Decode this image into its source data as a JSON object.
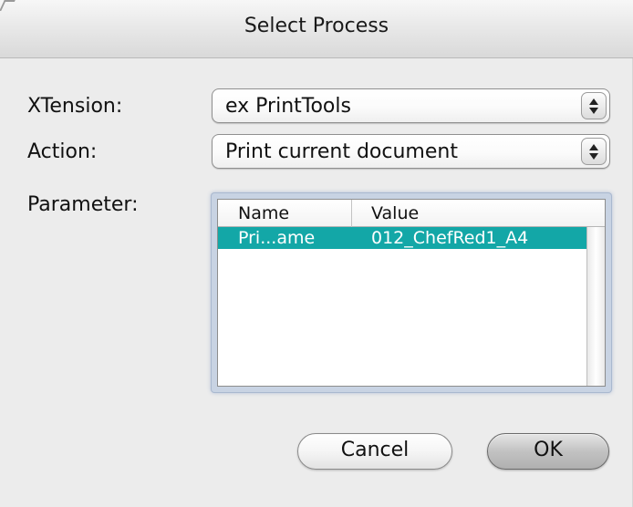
{
  "dialog": {
    "title": "Select Process"
  },
  "form": {
    "xtension_label": "XTension:",
    "xtension_value": "ex PrintTools",
    "action_label": "Action:",
    "action_value": "Print current document",
    "parameter_label": "Parameter:"
  },
  "parameter_table": {
    "columns": [
      "Name",
      "Value"
    ],
    "rows": [
      {
        "name": "Pri...ame",
        "value": "012_ChefRed1_A4",
        "selected": true
      }
    ],
    "selection_color": "#13a7a7"
  },
  "buttons": {
    "cancel": "Cancel",
    "ok": "OK"
  }
}
